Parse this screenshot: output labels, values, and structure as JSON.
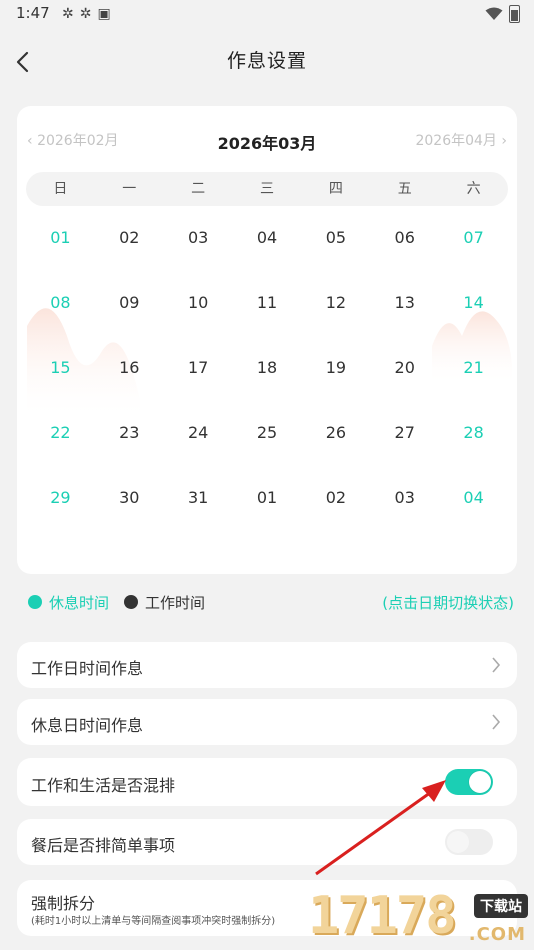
{
  "status": {
    "time": "1:47",
    "icons": [
      "settings-icon",
      "settings-icon",
      "app-badge-icon"
    ]
  },
  "header": {
    "title": "作息设置"
  },
  "calendar": {
    "prev_month": "2026年02月",
    "current_month": "2026年03月",
    "next_month": "2026年04月",
    "weekdays": [
      "日",
      "一",
      "二",
      "三",
      "四",
      "五",
      "六"
    ],
    "weeks": [
      [
        {
          "d": "01",
          "rest": true
        },
        {
          "d": "02",
          "rest": false
        },
        {
          "d": "03",
          "rest": false
        },
        {
          "d": "04",
          "rest": false
        },
        {
          "d": "05",
          "rest": false
        },
        {
          "d": "06",
          "rest": false
        },
        {
          "d": "07",
          "rest": true
        }
      ],
      [
        {
          "d": "08",
          "rest": true
        },
        {
          "d": "09",
          "rest": false
        },
        {
          "d": "10",
          "rest": false
        },
        {
          "d": "11",
          "rest": false
        },
        {
          "d": "12",
          "rest": false
        },
        {
          "d": "13",
          "rest": false
        },
        {
          "d": "14",
          "rest": true
        }
      ],
      [
        {
          "d": "15",
          "rest": true
        },
        {
          "d": "16",
          "rest": false
        },
        {
          "d": "17",
          "rest": false
        },
        {
          "d": "18",
          "rest": false
        },
        {
          "d": "19",
          "rest": false
        },
        {
          "d": "20",
          "rest": false
        },
        {
          "d": "21",
          "rest": true
        }
      ],
      [
        {
          "d": "22",
          "rest": true
        },
        {
          "d": "23",
          "rest": false
        },
        {
          "d": "24",
          "rest": false
        },
        {
          "d": "25",
          "rest": false
        },
        {
          "d": "26",
          "rest": false
        },
        {
          "d": "27",
          "rest": false
        },
        {
          "d": "28",
          "rest": true
        }
      ],
      [
        {
          "d": "29",
          "rest": true
        },
        {
          "d": "30",
          "rest": false
        },
        {
          "d": "31",
          "rest": false
        },
        {
          "d": "01",
          "rest": false
        },
        {
          "d": "02",
          "rest": false
        },
        {
          "d": "03",
          "rest": false
        },
        {
          "d": "04",
          "rest": true
        }
      ]
    ]
  },
  "legend": {
    "rest_label": "休息时间",
    "work_label": "工作时间",
    "hint": "(点击日期切换状态)"
  },
  "settings": {
    "workday_schedule": "工作日时间作息",
    "restday_schedule": "休息日时间作息",
    "mixed_schedule": {
      "label": "工作和生活是否混排",
      "on": true
    },
    "after_meal": {
      "label": "餐后是否排简单事项",
      "on": false
    },
    "force_split": {
      "label": "强制拆分",
      "desc": "(耗时1小时以上清单与等间隔查阅事项冲突时强制拆分)"
    }
  },
  "watermark": {
    "number": "17178",
    "badge": "下载站",
    "domain": ".COM"
  },
  "colors": {
    "accent": "#1bcfb4",
    "background": "#f2f2f2",
    "card": "#ffffff",
    "arrow": "#d9201f"
  }
}
